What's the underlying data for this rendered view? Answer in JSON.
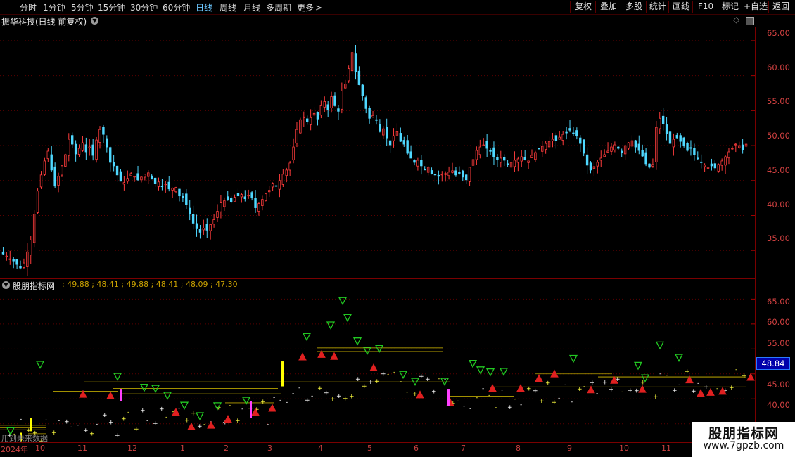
{
  "toolbar": {
    "periods": [
      "分时",
      "1分钟",
      "5分钟",
      "15分钟",
      "30分钟",
      "60分钟",
      "日线",
      "周线",
      "月线",
      "多周期",
      "更多"
    ],
    "active_period": "日线",
    "right_buttons": [
      "复权",
      "叠加",
      "多股",
      "统计",
      "画线",
      "F10",
      "标记",
      "+自选",
      "返回"
    ]
  },
  "stock": {
    "title": "振华科技(日线 前复权)"
  },
  "main_axis": [
    "65.00",
    "60.00",
    "55.00",
    "50.00",
    "45.00",
    "40.00",
    "35.00"
  ],
  "indicator": {
    "title": "股朋指标网",
    "values": ": 49.88 ; 48.41 ; 49.88 ; 48.41 ; 48.09 ; 47.30",
    "axis": [
      "65.00",
      "60.00",
      "55.00",
      "50.00",
      "45.00",
      "40.00"
    ],
    "current_badge": "48.84"
  },
  "date_axis": [
    "2024年",
    "10",
    "11",
    "12",
    "1",
    "2",
    "3",
    "4",
    "5",
    "6",
    "7",
    "8",
    "9",
    "10",
    "11"
  ],
  "bottom_note": "用到未来数据",
  "watermark": {
    "line1": "股朋指标网",
    "line2": "www.7gpzb.com"
  },
  "chart_data": {
    "type": "candlestick",
    "title": "振华科技(日线 前复权)",
    "y_axis_ticks": [
      65,
      60,
      55,
      50,
      45,
      40,
      35
    ],
    "ylim": [
      31,
      67
    ],
    "x_labels": [
      "2024年",
      "10",
      "11",
      "12",
      "1",
      "2",
      "3",
      "4",
      "5",
      "6",
      "7",
      "8",
      "9",
      "10",
      "11"
    ],
    "closes": [
      34.5,
      34.2,
      33.8,
      33.5,
      33.0,
      32.5,
      33.2,
      34.8,
      36.5,
      40.2,
      43.5,
      45.8,
      47.8,
      49.2,
      46.5,
      44.2,
      45.6,
      47.1,
      48.7,
      50.9,
      50.2,
      48.8,
      49.6,
      50.4,
      49.1,
      49.8,
      48.6,
      50.8,
      52.3,
      51.6,
      49.8,
      47.6,
      47.1,
      45.8,
      44.9,
      44.7,
      45.3,
      46.0,
      45.6,
      45.1,
      45.5,
      45.9,
      46.1,
      45.2,
      44.6,
      44.8,
      44.2,
      44.5,
      43.8,
      43.9,
      44.0,
      42.8,
      42.6,
      41.5,
      40.2,
      38.9,
      38.1,
      37.6,
      38.2,
      37.9,
      38.7,
      39.4,
      40.6,
      41.8,
      42.1,
      42.3,
      42.0,
      42.6,
      42.8,
      43.0,
      42.4,
      42.9,
      42.6,
      41.1,
      41.7,
      42.3,
      43.1,
      43.6,
      44.6,
      44.2,
      45.0,
      45.9,
      46.5,
      47.5,
      49.8,
      52.3,
      53.7,
      54.1,
      53.4,
      54.0,
      54.6,
      53.8,
      55.7,
      56.3,
      55.1,
      57.0,
      55.7,
      54.9,
      57.8,
      58.8,
      61.0,
      63.3,
      60.5,
      58.7,
      57.1,
      55.3,
      53.9,
      54.3,
      53.6,
      52.0,
      52.4,
      51.1,
      50.1,
      51.4,
      52.0,
      50.6,
      50.2,
      48.9,
      48.2,
      47.6,
      47.9,
      47.1,
      46.6,
      46.9,
      46.0,
      45.8,
      45.6,
      45.9,
      46.0,
      46.2,
      46.4,
      45.8,
      46.1,
      45.5,
      45.1,
      46.9,
      48.0,
      49.3,
      49.8,
      50.1,
      49.6,
      49.2,
      48.4,
      48.0,
      48.2,
      47.9,
      47.4,
      47.6,
      47.9,
      48.1,
      48.4,
      48.0,
      47.8,
      48.6,
      49.0,
      49.5,
      49.9,
      50.3,
      50.6,
      50.9,
      50.7,
      51.2,
      51.6,
      51.9,
      52.2,
      51.8,
      51.4,
      50.3,
      48.9,
      47.2,
      46.5,
      47.0,
      47.6,
      48.2,
      48.7,
      49.2,
      49.8,
      50.1,
      49.6,
      49.0,
      50.0,
      50.4,
      50.7,
      49.8,
      49.3,
      48.5,
      47.4,
      46.9,
      47.3,
      52.6,
      53.9,
      53.1,
      51.7,
      50.3,
      50.9,
      51.1,
      50.6,
      50.0,
      49.3,
      49.6,
      48.7,
      48.1,
      47.6,
      47.2,
      46.9,
      47.1,
      46.8,
      47.3,
      47.8,
      48.4,
      49.1,
      49.6,
      50.2,
      50.0,
      49.4,
      50.2
    ]
  },
  "indicator_data": {
    "type": "scatter",
    "ylim": [
      37,
      69
    ],
    "y_axis_ticks": [
      65,
      60,
      55,
      50,
      45,
      40
    ],
    "markers": [
      {
        "kind": "down-triangle",
        "color": "#22c822",
        "x": 15,
        "y": 38.5
      },
      {
        "kind": "down-triangle",
        "color": "#22c822",
        "x": 57,
        "y": 51.8
      },
      {
        "kind": "down-triangle",
        "color": "#22c822",
        "x": 167,
        "y": 49.4
      },
      {
        "kind": "down-triangle",
        "color": "#22c822",
        "x": 205,
        "y": 47.2
      },
      {
        "kind": "down-triangle",
        "color": "#22c822",
        "x": 221,
        "y": 47.0
      },
      {
        "kind": "down-triangle",
        "color": "#22c822",
        "x": 238,
        "y": 45.6
      },
      {
        "kind": "down-triangle",
        "color": "#22c822",
        "x": 262,
        "y": 43.6
      },
      {
        "kind": "down-triangle",
        "color": "#22c822",
        "x": 284,
        "y": 41.5
      },
      {
        "kind": "down-triangle",
        "color": "#22c822",
        "x": 309,
        "y": 43.5
      },
      {
        "kind": "down-triangle",
        "color": "#22c822",
        "x": 350,
        "y": 44.6
      },
      {
        "kind": "down-triangle",
        "color": "#22c822",
        "x": 436,
        "y": 57.4
      },
      {
        "kind": "down-triangle",
        "color": "#22c822",
        "x": 470,
        "y": 59.7
      },
      {
        "kind": "down-triangle",
        "color": "#22c822",
        "x": 487,
        "y": 64.6
      },
      {
        "kind": "down-triangle",
        "color": "#22c822",
        "x": 494,
        "y": 61.2
      },
      {
        "kind": "down-triangle",
        "color": "#22c822",
        "x": 508,
        "y": 56.5
      },
      {
        "kind": "down-triangle",
        "color": "#22c822",
        "x": 522,
        "y": 54.6
      },
      {
        "kind": "down-triangle",
        "color": "#22c822",
        "x": 539,
        "y": 55.0
      },
      {
        "kind": "down-triangle",
        "color": "#22c822",
        "x": 573,
        "y": 49.8
      },
      {
        "kind": "down-triangle",
        "color": "#22c822",
        "x": 590,
        "y": 48.4
      },
      {
        "kind": "down-triangle",
        "color": "#22c822",
        "x": 632,
        "y": 48.4
      },
      {
        "kind": "down-triangle",
        "color": "#22c822",
        "x": 672,
        "y": 52.0
      },
      {
        "kind": "down-triangle",
        "color": "#22c822",
        "x": 683,
        "y": 50.7
      },
      {
        "kind": "down-triangle",
        "color": "#22c822",
        "x": 697,
        "y": 50.3
      },
      {
        "kind": "down-triangle",
        "color": "#22c822",
        "x": 716,
        "y": 50.4
      },
      {
        "kind": "down-triangle",
        "color": "#22c822",
        "x": 815,
        "y": 53.0
      },
      {
        "kind": "down-triangle",
        "color": "#22c822",
        "x": 907,
        "y": 51.6
      },
      {
        "kind": "down-triangle",
        "color": "#22c822",
        "x": 917,
        "y": 49.1
      },
      {
        "kind": "down-triangle",
        "color": "#22c822",
        "x": 938,
        "y": 55.7
      },
      {
        "kind": "down-triangle",
        "color": "#22c822",
        "x": 965,
        "y": 53.2
      },
      {
        "kind": "up-triangle",
        "color": "#e02020",
        "x": 118,
        "y": 46.0
      },
      {
        "kind": "up-triangle",
        "color": "#e02020",
        "x": 157,
        "y": 45.7
      },
      {
        "kind": "up-triangle",
        "color": "#e02020",
        "x": 250,
        "y": 42.4
      },
      {
        "kind": "up-triangle",
        "color": "#e02020",
        "x": 272,
        "y": 39.5
      },
      {
        "kind": "up-triangle",
        "color": "#e02020",
        "x": 300,
        "y": 39.8
      },
      {
        "kind": "up-triangle",
        "color": "#e02020",
        "x": 324,
        "y": 41.0
      },
      {
        "kind": "up-triangle",
        "color": "#e02020",
        "x": 363,
        "y": 42.4
      },
      {
        "kind": "up-triangle",
        "color": "#e02020",
        "x": 387,
        "y": 43.2
      },
      {
        "kind": "up-triangle",
        "color": "#e02020",
        "x": 430,
        "y": 53.5
      },
      {
        "kind": "up-triangle",
        "color": "#e02020",
        "x": 457,
        "y": 54.0
      },
      {
        "kind": "up-triangle",
        "color": "#e02020",
        "x": 475,
        "y": 53.6
      },
      {
        "kind": "up-triangle",
        "color": "#e02020",
        "x": 531,
        "y": 51.3
      },
      {
        "kind": "up-triangle",
        "color": "#e02020",
        "x": 597,
        "y": 45.9
      },
      {
        "kind": "up-triangle",
        "color": "#e02020",
        "x": 640,
        "y": 44.3
      },
      {
        "kind": "up-triangle",
        "color": "#e02020",
        "x": 700,
        "y": 47.2
      },
      {
        "kind": "up-triangle",
        "color": "#e02020",
        "x": 740,
        "y": 47.2
      },
      {
        "kind": "up-triangle",
        "color": "#e02020",
        "x": 766,
        "y": 49.2
      },
      {
        "kind": "up-triangle",
        "color": "#e02020",
        "x": 788,
        "y": 50.1
      },
      {
        "kind": "up-triangle",
        "color": "#e02020",
        "x": 840,
        "y": 46.9
      },
      {
        "kind": "up-triangle",
        "color": "#e02020",
        "x": 873,
        "y": 48.8
      },
      {
        "kind": "up-triangle",
        "color": "#e02020",
        "x": 913,
        "y": 47.0
      },
      {
        "kind": "up-triangle",
        "color": "#e02020",
        "x": 980,
        "y": 48.9
      },
      {
        "kind": "up-triangle",
        "color": "#e02020",
        "x": 996,
        "y": 46.2
      },
      {
        "kind": "up-triangle",
        "color": "#e02020",
        "x": 1010,
        "y": 46.4
      },
      {
        "kind": "up-triangle",
        "color": "#e02020",
        "x": 1027,
        "y": 46.6
      },
      {
        "kind": "up-triangle",
        "color": "#e02020",
        "x": 1067,
        "y": 49.4
      }
    ]
  }
}
